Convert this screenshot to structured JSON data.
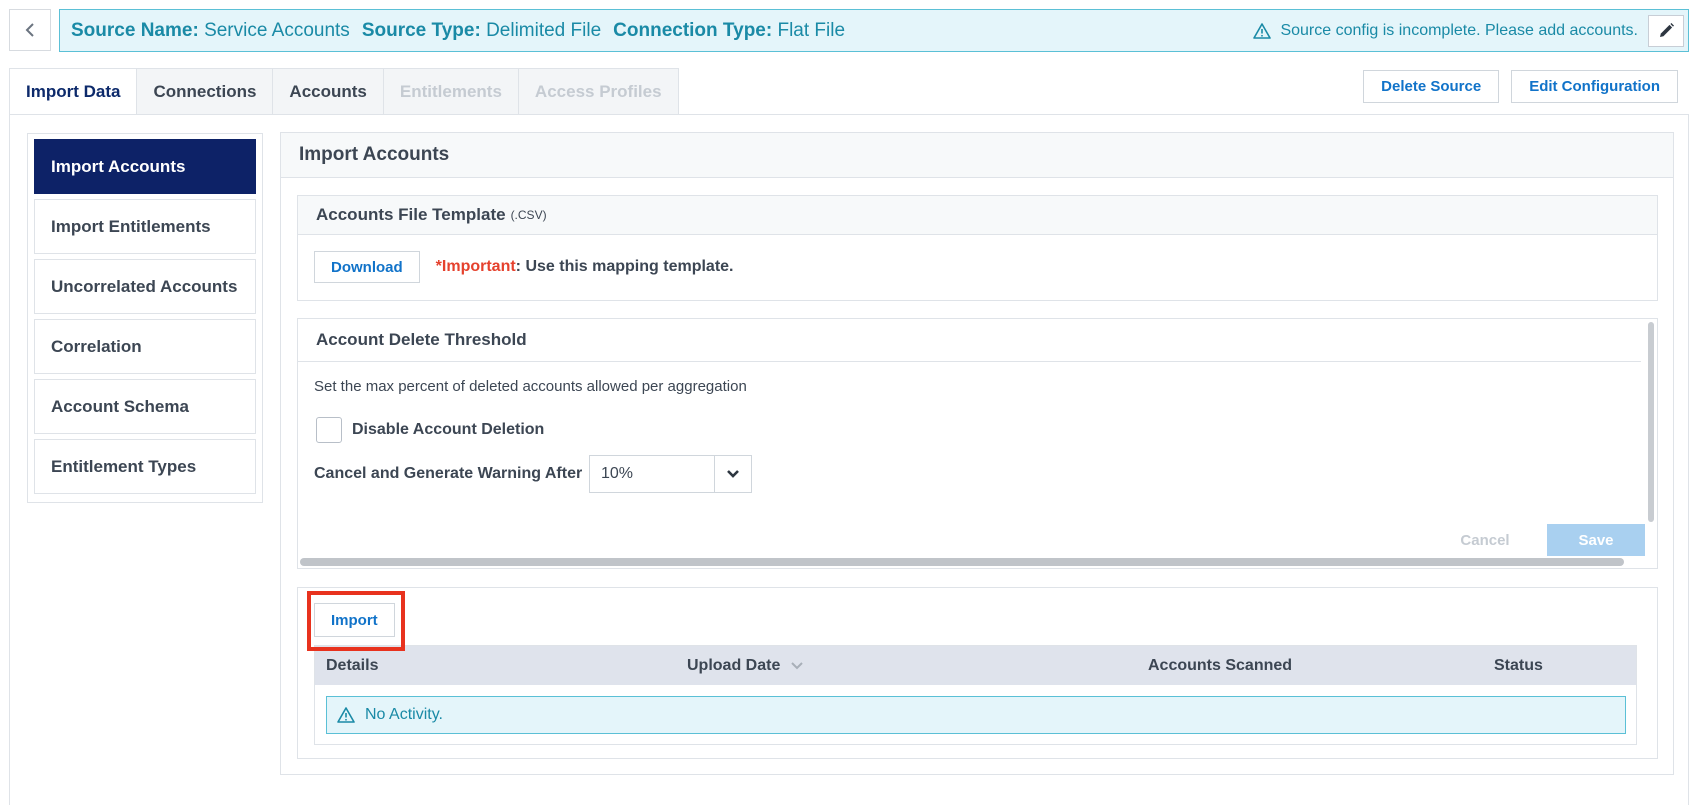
{
  "header": {
    "source_name_label": "Source Name:",
    "source_name": "Service Accounts",
    "source_type_label": "Source Type:",
    "source_type": "Delimited File",
    "connection_type_label": "Connection Type:",
    "connection_type": "Flat File",
    "warning": "Source config is incomplete. Please add accounts.",
    "icons": {
      "back": "chevron-left-icon",
      "warning": "warning-triangle-icon",
      "edit": "pencil-icon"
    }
  },
  "tabs": [
    {
      "label": "Import Data",
      "state": "active"
    },
    {
      "label": "Connections",
      "state": "normal"
    },
    {
      "label": "Accounts",
      "state": "normal"
    },
    {
      "label": "Entitlements",
      "state": "disabled"
    },
    {
      "label": "Access Profiles",
      "state": "disabled"
    }
  ],
  "actions": {
    "delete_source": "Delete Source",
    "edit_configuration": "Edit Configuration"
  },
  "side_menu": [
    {
      "label": "Import Accounts",
      "active": true
    },
    {
      "label": "Import Entitlements",
      "active": false
    },
    {
      "label": "Uncorrelated Accounts",
      "active": false
    },
    {
      "label": "Correlation",
      "active": false
    },
    {
      "label": "Account Schema",
      "active": false
    },
    {
      "label": "Entitlement Types",
      "active": false
    }
  ],
  "main": {
    "title": "Import Accounts",
    "template_card": {
      "title": "Accounts File Template",
      "subtitle": "(.CSV)",
      "download": "Download",
      "important_label": "*Important",
      "important_text": ": Use this mapping template."
    },
    "threshold_card": {
      "title": "Account Delete Threshold",
      "description": "Set the max percent of deleted accounts allowed per aggregation",
      "disable_label": "Disable Account Deletion",
      "disable_checked": false,
      "cancel_after_label": "Cancel and Generate Warning After",
      "cancel_after_value": "10%",
      "cancel": "Cancel",
      "save": "Save"
    },
    "import_card": {
      "import": "Import",
      "columns": [
        "Details",
        "Upload Date",
        "Accounts Scanned",
        "Status"
      ],
      "empty": "No Activity."
    }
  },
  "colors": {
    "accent": "#1173c9",
    "nav_active": "#0d2267",
    "info": "#1a8aa6",
    "highlight": "#e8321e",
    "important": "#e5412d"
  }
}
